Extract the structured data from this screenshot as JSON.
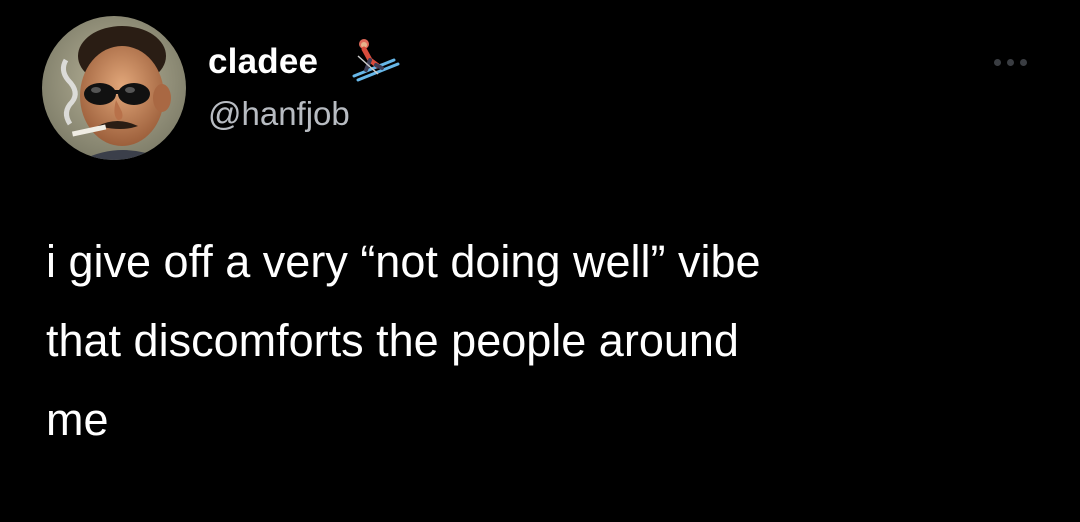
{
  "tweet": {
    "user": {
      "display_name": "cladee",
      "handle": "@hanfjob",
      "avatar_icon": "smoking-man-sunglasses-avatar",
      "badge_icon": "skier-emoji-icon"
    },
    "more_icon": "ellipsis-icon",
    "text": "i give off a very “not doing well” vibe\nthat discomforts the people around\nme"
  },
  "colors": {
    "background": "#000000",
    "primary_text": "#ffffff",
    "secondary_text": "#b8bcc2",
    "muted_icon": "#3a3d42"
  }
}
